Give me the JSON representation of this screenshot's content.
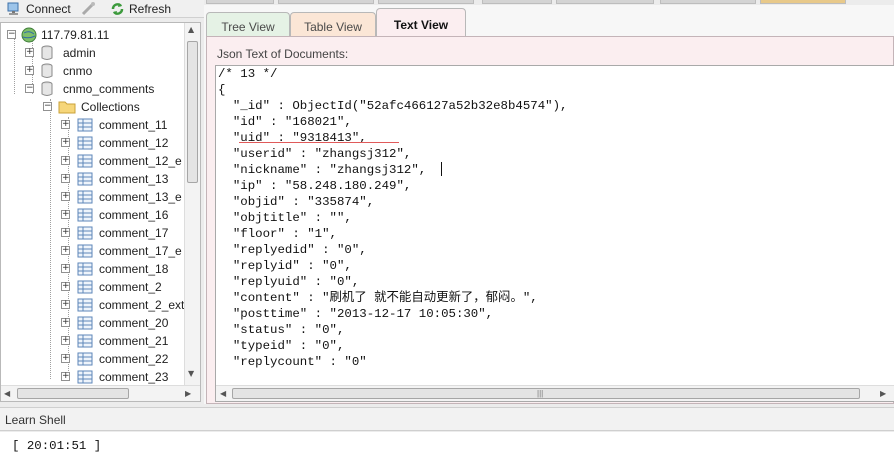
{
  "toolbar": {
    "connect_label": "Connect",
    "refresh_label": "Refresh"
  },
  "tree": {
    "server": "117.79.81.11",
    "databases": [
      "admin",
      "cnmo",
      "cnmo_comments"
    ],
    "collections_folder": "Collections",
    "collections": [
      "comment_11",
      "comment_12",
      "comment_12_e",
      "comment_13",
      "comment_13_e",
      "comment_16",
      "comment_17",
      "comment_17_e",
      "comment_18",
      "comment_2",
      "comment_2_ext",
      "comment_20",
      "comment_21",
      "comment_22",
      "comment_23"
    ]
  },
  "tabs": [
    {
      "label": "Tree View"
    },
    {
      "label": "Table View"
    },
    {
      "label": "Text View"
    }
  ],
  "active_tab": "Text View",
  "document_label": "Json Text of Documents:",
  "json_lines": [
    "/* 13 */",
    "{",
    "  \"_id\" : ObjectId(\"52afc466127a52b32e8b4574\"),",
    "  \"id\" : \"168021\",",
    "  \"uid\" : \"9318413\",",
    "  \"userid\" : \"zhangsj312\",",
    "  \"nickname\" : \"zhangsj312\",",
    "  \"ip\" : \"58.248.180.249\",",
    "  \"objid\" : \"335874\",",
    "  \"objtitle\" : \"\",",
    "  \"floor\" : \"1\",",
    "  \"replyedid\" : \"0\",",
    "  \"replyid\" : \"0\",",
    "  \"replyuid\" : \"0\",",
    "  \"content\" : \"刷机了 就不能自动更新了，郁闷。\",",
    "  \"posttime\" : \"2013-12-17 10:05:30\",",
    "  \"status\" : \"0\",",
    "  \"typeid\" : \"0\",",
    "  \"replycount\" : \"0\""
  ],
  "shell": {
    "title": "Learn Shell",
    "lines": [
      "[ 20:01:51 ]"
    ]
  },
  "colors": {
    "tab_active": "#fbeef0",
    "tab_tree": "#e5f2e5",
    "tab_table": "#fbe6d6",
    "underline": "#e05a5a"
  }
}
